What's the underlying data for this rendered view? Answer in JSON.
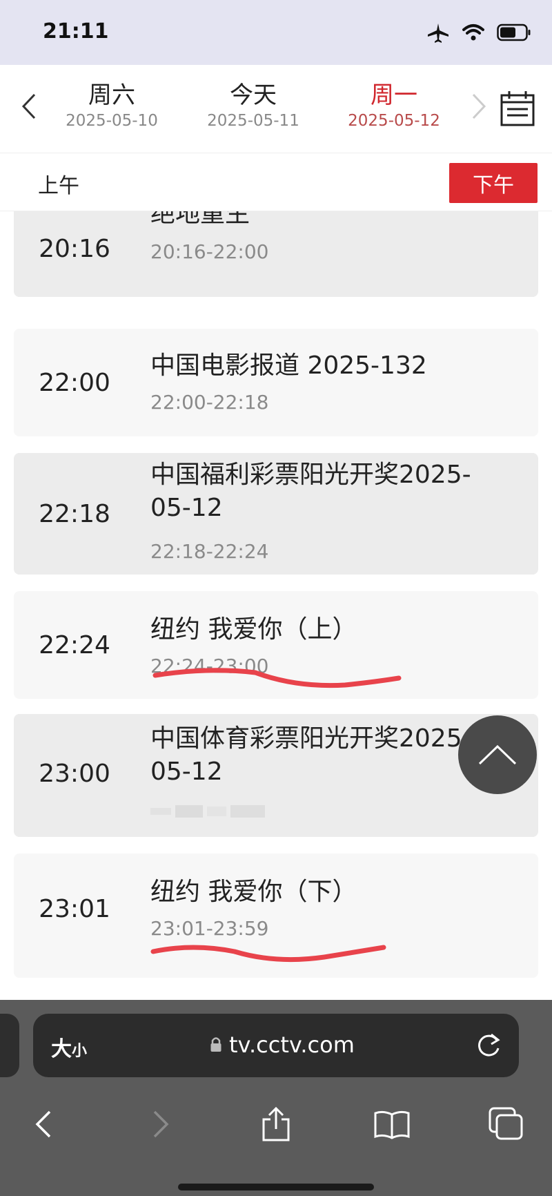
{
  "status_bar": {
    "time": "21:11"
  },
  "date_nav": {
    "days": [
      {
        "name": "周六",
        "date": "2025-05-10",
        "active": false
      },
      {
        "name": "今天",
        "date": "2025-05-11",
        "active": false
      },
      {
        "name": "周一",
        "date": "2025-05-12",
        "active": true
      }
    ]
  },
  "period": {
    "am_label": "上午",
    "pm_label": "下午",
    "selected": "下午"
  },
  "programs": [
    {
      "time": "20:16",
      "title": "绝地重生",
      "range": "20:16-22:00"
    },
    {
      "time": "22:00",
      "title": "中国电影报道 2025-132",
      "range": "22:00-22:18"
    },
    {
      "time": "22:18",
      "title": "中国福利彩票阳光开奖2025-05-12",
      "title_line1": "中国福利彩票阳光开奖2025-",
      "title_line2": "05-12",
      "range": "22:18-22:24"
    },
    {
      "time": "22:24",
      "title": "纽约 我爱你（上）",
      "range": "22:24-23:00"
    },
    {
      "time": "23:00",
      "title": "中国体育彩票阳光开奖2025-05-12",
      "title_line1": "中国体育彩票阳光开奖2025-",
      "title_line2": "05-12",
      "range": ""
    },
    {
      "time": "23:01",
      "title": "纽约 我爱你（下）",
      "range": "23:01-23:59"
    }
  ],
  "browser": {
    "text_size_big": "大",
    "text_size_small": "小",
    "url": "tv.cctv.com"
  },
  "icons": {
    "status": [
      "airplane-icon",
      "wifi-icon",
      "battery-icon"
    ],
    "nav": [
      "chevron-left-icon",
      "chevron-right-icon",
      "calendar-icon"
    ],
    "toolbar": [
      "back-icon",
      "forward-icon",
      "share-icon",
      "bookmarks-icon",
      "tabs-icon"
    ]
  },
  "colors": {
    "accent": "#dc2a30",
    "active_day": "#d0262d",
    "scribble": "#e8434b"
  }
}
